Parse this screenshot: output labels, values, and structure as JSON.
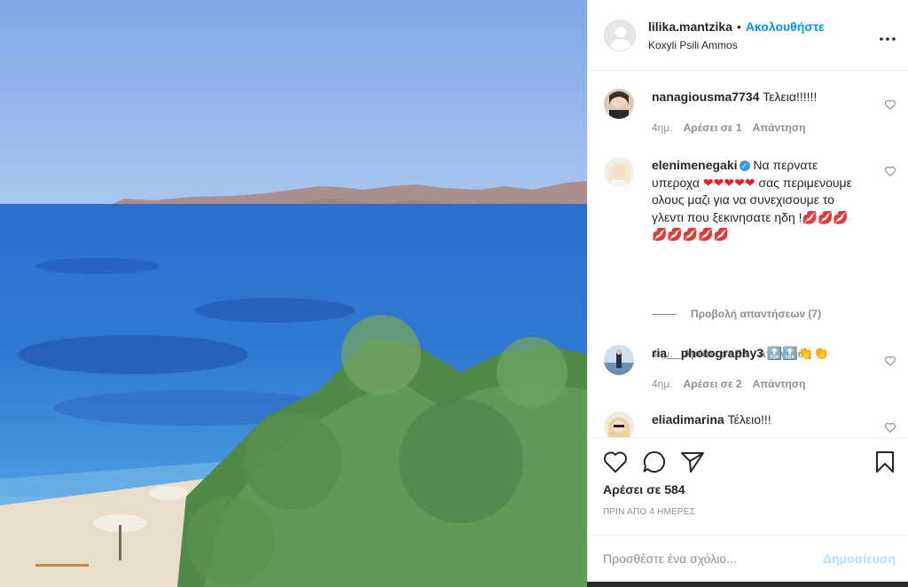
{
  "post": {
    "username": "lilika.mantzika",
    "separator": "•",
    "follow_label": "Ακολουθήστε",
    "location": "Koxyli Psili Ammos",
    "more_icon": "more-horizontal-icon"
  },
  "comments": [
    {
      "username": "nanagiousma7734",
      "text": "Τελεια!!!!!!",
      "time": "4ημ.",
      "likes": "Αρέσει σε 1",
      "reply": "Απάντηση"
    },
    {
      "username": "elenimenegaki",
      "verified": true,
      "text_part1": "Να περνατε υπεροχα",
      "hearts": "❤❤❤❤❤",
      "text_part2": "σας περιμενουμε ολους μαζι για να συνεχισουμε το γλεντι που ξεκινησατε ηδη !",
      "lips": "💋💋💋💋💋💋💋💋",
      "time": "4ημ.",
      "likes": "Αρέσει σε 55",
      "reply": "Απάντηση",
      "view_replies": "Προβολή απαντήσεων (7)"
    },
    {
      "username": "ria__photography3",
      "text": "🔝🔝👏👏",
      "time": "4ημ.",
      "likes": "Αρέσει σε 2",
      "reply": "Απάντηση"
    },
    {
      "username": "eliadimarina",
      "text": "Τέλειο!!!"
    }
  ],
  "actions": {
    "like_icon": "heart-icon",
    "comment_icon": "comment-icon",
    "share_icon": "send-icon",
    "save_icon": "bookmark-icon",
    "likes_count": "Αρέσει σε 584",
    "posted_ago": "ΠΡΙΝ ΑΠΟ 4 ΗΜΕΡΕΣ"
  },
  "add_comment": {
    "placeholder": "Προσθέστε ένα σχόλιο...",
    "post_label": "Δημοσίευση"
  },
  "colors": {
    "accent": "#0095f6",
    "post_disabled": "#b2dffc",
    "muted": "#8e8e8e"
  }
}
